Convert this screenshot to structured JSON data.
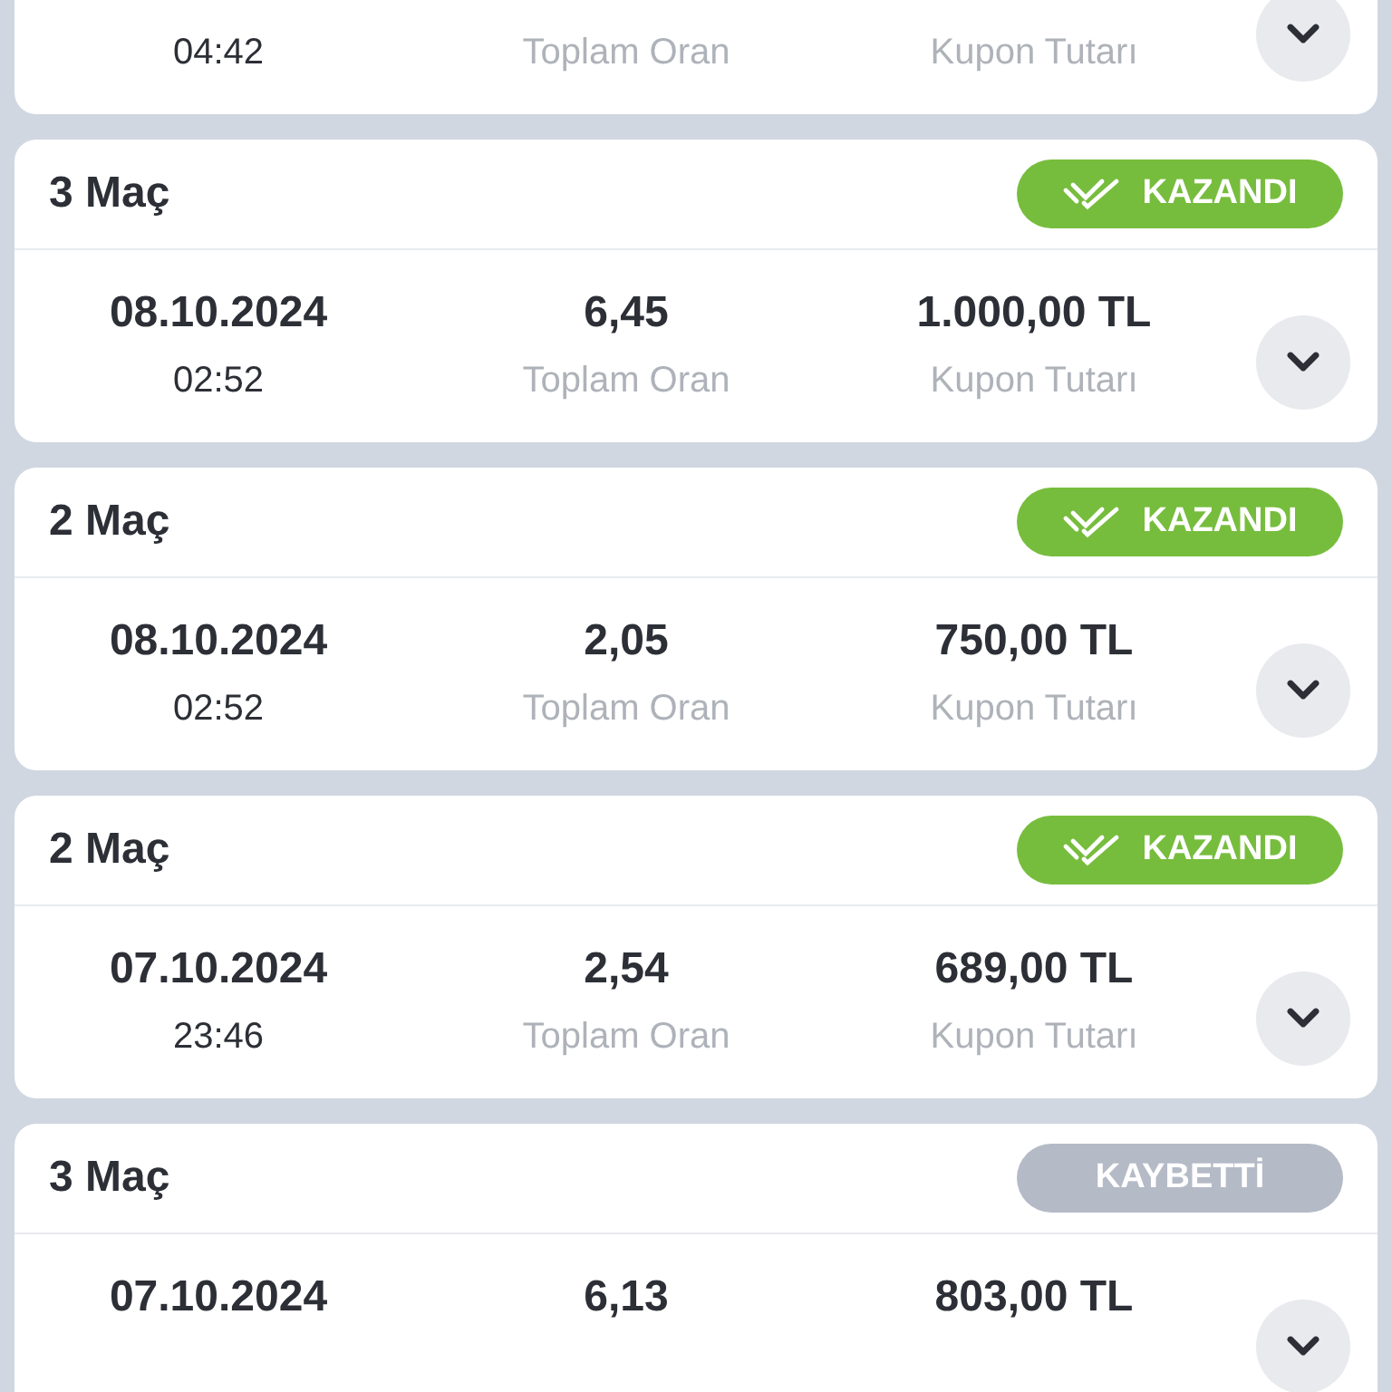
{
  "coupons": [
    {
      "time": "04:42",
      "odds_label": "Toplam Oran",
      "amount_label": "Kupon Tutarı"
    },
    {
      "matches": "3 Maç",
      "status": {
        "kind": "won",
        "label": "KAZANDI"
      },
      "date": "08.10.2024",
      "time": "02:52",
      "odds": "6,45",
      "odds_label": "Toplam Oran",
      "amount": "1.000,00 TL",
      "amount_label": "Kupon Tutarı"
    },
    {
      "matches": "2 Maç",
      "status": {
        "kind": "won",
        "label": "KAZANDI"
      },
      "date": "08.10.2024",
      "time": "02:52",
      "odds": "2,05",
      "odds_label": "Toplam Oran",
      "amount": "750,00 TL",
      "amount_label": "Kupon Tutarı"
    },
    {
      "matches": "2 Maç",
      "status": {
        "kind": "won",
        "label": "KAZANDI"
      },
      "date": "07.10.2024",
      "time": "23:46",
      "odds": "2,54",
      "odds_label": "Toplam Oran",
      "amount": "689,00 TL",
      "amount_label": "Kupon Tutarı"
    },
    {
      "matches": "3 Maç",
      "status": {
        "kind": "lost",
        "label": "KAYBETTİ"
      },
      "date": "07.10.2024",
      "odds": "6,13",
      "amount": "803,00 TL"
    }
  ]
}
